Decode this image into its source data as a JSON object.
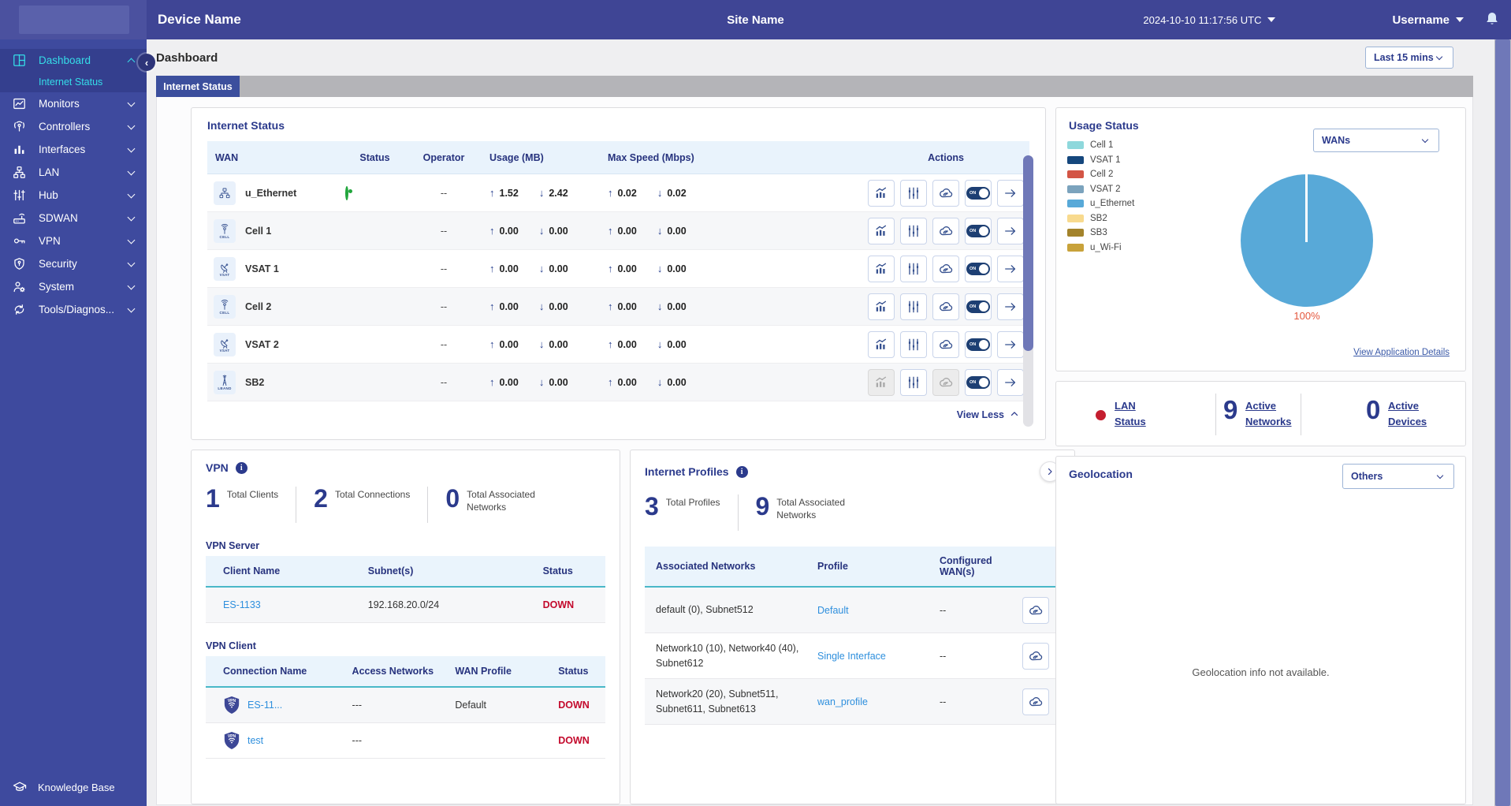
{
  "header": {
    "device_name": "Device Name",
    "site_name": "Site Name",
    "timestamp": "2024-10-10 11:17:56 UTC",
    "username": "Username"
  },
  "sidebar": {
    "items": [
      {
        "id": "dashboard",
        "label": "Dashboard",
        "active": true,
        "expanded": true
      },
      {
        "id": "monitors",
        "label": "Monitors"
      },
      {
        "id": "controllers",
        "label": "Controllers"
      },
      {
        "id": "interfaces",
        "label": "Interfaces"
      },
      {
        "id": "lan",
        "label": "LAN"
      },
      {
        "id": "hub",
        "label": "Hub"
      },
      {
        "id": "sdwan",
        "label": "SDWAN"
      },
      {
        "id": "vpn",
        "label": "VPN"
      },
      {
        "id": "security",
        "label": "Security"
      },
      {
        "id": "system",
        "label": "System"
      },
      {
        "id": "tools",
        "label": "Tools/Diagnos..."
      }
    ],
    "sub_item": {
      "label": "Internet Status",
      "parent": "dashboard",
      "active": true
    },
    "knowledge_base": "Knowledge Base"
  },
  "page": {
    "title": "Dashboard",
    "time_range": "Last 15 mins",
    "tab": "Internet Status"
  },
  "internet_status": {
    "title": "Internet Status",
    "columns": [
      "WAN",
      "Status",
      "Operator",
      "Usage (MB)",
      "Max Speed (Mbps)",
      "Actions"
    ],
    "rows": [
      {
        "name": "u_Ethernet",
        "icon": "ethernet",
        "caption": "",
        "status": "up",
        "operator": "--",
        "usage_up": "1.52",
        "usage_down": "2.42",
        "speed_up": "0.02",
        "speed_down": "0.02",
        "disabled_actions": []
      },
      {
        "name": "Cell 1",
        "icon": "cell",
        "caption": "CELL",
        "status": "down",
        "operator": "--",
        "usage_up": "0.00",
        "usage_down": "0.00",
        "speed_up": "0.00",
        "speed_down": "0.00",
        "disabled_actions": []
      },
      {
        "name": "VSAT 1",
        "icon": "vsat",
        "caption": "VSAT",
        "status": "down",
        "operator": "--",
        "usage_up": "0.00",
        "usage_down": "0.00",
        "speed_up": "0.00",
        "speed_down": "0.00",
        "disabled_actions": []
      },
      {
        "name": "Cell 2",
        "icon": "cell",
        "caption": "CELL",
        "status": "down",
        "operator": "--",
        "usage_up": "0.00",
        "usage_down": "0.00",
        "speed_up": "0.00",
        "speed_down": "0.00",
        "disabled_actions": []
      },
      {
        "name": "VSAT 2",
        "icon": "vsat",
        "caption": "VSAT",
        "status": "down",
        "operator": "--",
        "usage_up": "0.00",
        "usage_down": "0.00",
        "speed_up": "0.00",
        "speed_down": "0.00",
        "disabled_actions": []
      },
      {
        "name": "SB2",
        "icon": "lband",
        "caption": "LBAND",
        "status": "down",
        "operator": "--",
        "usage_up": "0.00",
        "usage_down": "0.00",
        "speed_up": "0.00",
        "speed_down": "0.00",
        "disabled_actions": [
          "chart",
          "gauge"
        ]
      }
    ],
    "view_less": "View Less",
    "status_colors": {
      "up": "#21a63c",
      "down": "#c8202f"
    }
  },
  "usage_status": {
    "title": "Usage Status",
    "selector": "WANs",
    "legend": [
      {
        "label": "Cell 1",
        "color": "#8ed8dc"
      },
      {
        "label": "VSAT 1",
        "color": "#15477d"
      },
      {
        "label": "Cell 2",
        "color": "#d35545"
      },
      {
        "label": "VSAT 2",
        "color": "#7ba3bd"
      },
      {
        "label": "u_Ethernet",
        "color": "#58a9d8"
      },
      {
        "label": "SB2",
        "color": "#f8da8e"
      },
      {
        "label": "SB3",
        "color": "#a3832b"
      },
      {
        "label": "u_Wi-Fi",
        "color": "#c8a23a"
      }
    ],
    "pie_label": "100%",
    "link": "View Application Details"
  },
  "chart_data": {
    "type": "pie",
    "title": "Usage Status",
    "categories": [
      "Cell 1",
      "VSAT 1",
      "Cell 2",
      "VSAT 2",
      "u_Ethernet",
      "SB2",
      "SB3",
      "u_Wi-Fi"
    ],
    "values": [
      0,
      0,
      0,
      0,
      100,
      0,
      0,
      0
    ],
    "unit": "%",
    "colors": [
      "#8ed8dc",
      "#15477d",
      "#d35545",
      "#7ba3bd",
      "#58a9d8",
      "#f8da8e",
      "#a3832b",
      "#c8a23a"
    ],
    "data_label": "100%",
    "legend_position": "left"
  },
  "lan_status": {
    "label": "LAN Status",
    "indicator_color": "#c41e2f",
    "stats": [
      {
        "value": "9",
        "label": "Active Networks"
      },
      {
        "value": "0",
        "label": "Active Devices"
      }
    ]
  },
  "vpn": {
    "title": "VPN",
    "stats": [
      {
        "value": "1",
        "label": "Total Clients"
      },
      {
        "value": "2",
        "label": "Total Connections"
      },
      {
        "value": "0",
        "label": "Total Associated Networks"
      }
    ],
    "server": {
      "title": "VPN Server",
      "columns": [
        "Client Name",
        "Subnet(s)",
        "Status"
      ],
      "rows": [
        {
          "client_name": "ES-1133",
          "subnets": "192.168.20.0/24",
          "status": "DOWN"
        }
      ]
    },
    "client": {
      "title": "VPN Client",
      "columns": [
        "Connection Name",
        "Access Networks",
        "WAN Profile",
        "Status"
      ],
      "rows": [
        {
          "connection_name": "ES-11...",
          "access_networks": "---",
          "wan_profile": "Default",
          "status": "DOWN"
        },
        {
          "connection_name": "test",
          "access_networks": "---",
          "wan_profile": "",
          "status": "DOWN"
        }
      ]
    }
  },
  "internet_profiles": {
    "title": "Internet Profiles",
    "stats": [
      {
        "value": "3",
        "label": "Total Profiles"
      },
      {
        "value": "9",
        "label": "Total Associated Networks"
      }
    ],
    "columns": [
      "Associated Networks",
      "Profile",
      "Configured WAN(s)"
    ],
    "rows": [
      {
        "networks": "default (0), Subnet512",
        "profile": "Default",
        "wans": "--"
      },
      {
        "networks": "Network10 (10), Network40 (40), Subnet612",
        "profile": "Single Interface",
        "wans": "--"
      },
      {
        "networks": "Network20 (20), Subnet511, Subnet611, Subnet613",
        "profile": "wan_profile",
        "wans": "--"
      }
    ]
  },
  "geolocation": {
    "title": "Geolocation",
    "selector": "Others",
    "message": "Geolocation info not available."
  }
}
